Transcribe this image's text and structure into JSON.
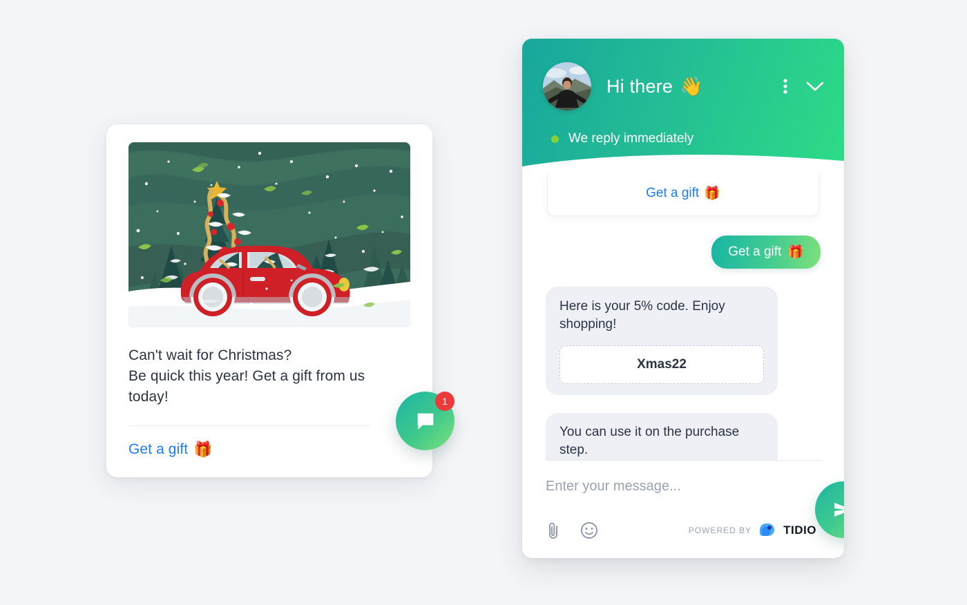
{
  "page": {
    "background_color": "#f4f5f7"
  },
  "promo_card": {
    "illustration_alt": "christmas-car-illustration",
    "headline_line1": "Can't wait for Christmas?",
    "headline_line2": "Be quick this year! Get a gift from us",
    "headline_line3": "today!",
    "link_label": "Get a gift",
    "link_emoji": "🎁",
    "link_color": "#1d7df5"
  },
  "launcher": {
    "icon": "chat-bubble-icon",
    "badge_count": "1",
    "badge_color": "#ec3a3a",
    "gradient_from": "#1cb5a3",
    "gradient_to": "#7fe07c"
  },
  "widget": {
    "header": {
      "avatar": "agent-avatar",
      "title": "Hi there",
      "title_emoji": "👋",
      "menu_icon": "more-vertical-icon",
      "collapse_icon": "chevron-down-icon",
      "status_text": "We reply immediately",
      "status_dot_color": "#86cf34",
      "gradient_from": "#17a79c",
      "gradient_to": "#2ddc86"
    },
    "messages": [
      {
        "type": "card-link",
        "label": "Get a gift",
        "emoji": "🎁"
      },
      {
        "type": "user",
        "label": "Get a gift",
        "emoji": "🎁"
      },
      {
        "type": "bot",
        "text": "Here is your 5% code. Enjoy shopping!",
        "code": "Xmas22"
      },
      {
        "type": "bot",
        "text": "You can use it on the purchase step."
      }
    ],
    "composer": {
      "placeholder": "Enter your message...",
      "value": "",
      "attach_icon": "paperclip-icon",
      "emoji_icon": "smiley-icon",
      "send_icon": "send-icon",
      "powered_by_label": "POWERED BY",
      "brand_name": "TIDIO",
      "brand_mark": "tidio-logo-icon",
      "brand_color": "#2f8af5"
    }
  }
}
